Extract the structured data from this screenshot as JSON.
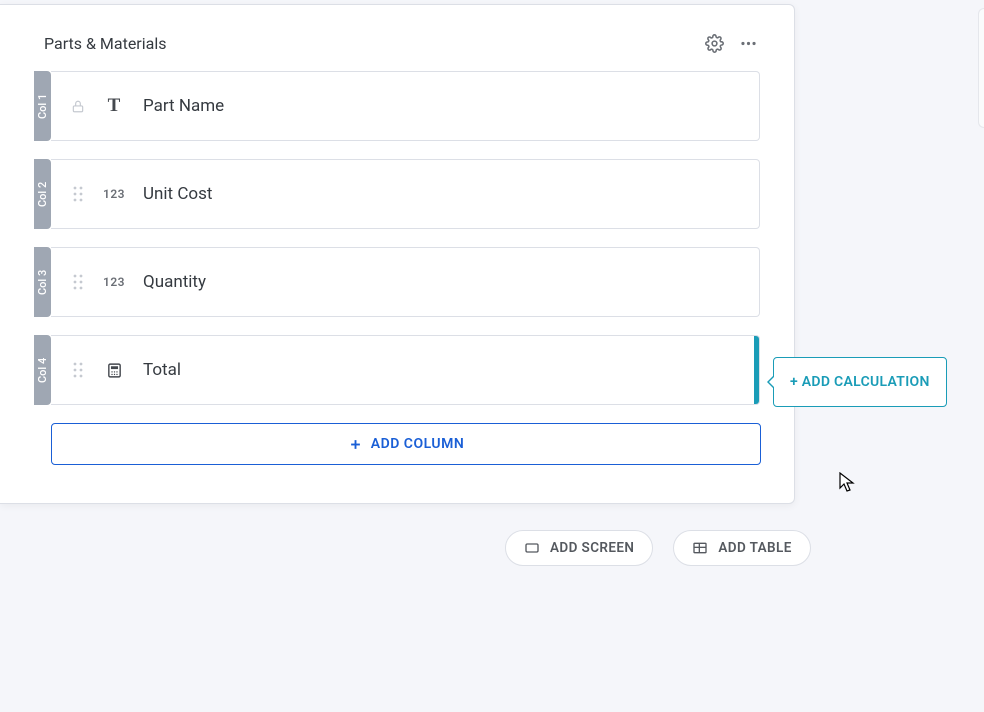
{
  "panel": {
    "title": "Parts & Materials"
  },
  "columns": [
    {
      "tab": "Col 1",
      "name": "Part Name",
      "type": "text",
      "locked": true,
      "active": false
    },
    {
      "tab": "Col 2",
      "name": "Unit Cost",
      "type": "number",
      "locked": false,
      "active": false
    },
    {
      "tab": "Col 3",
      "name": "Quantity",
      "type": "number",
      "locked": false,
      "active": false
    },
    {
      "tab": "Col 4",
      "name": "Total",
      "type": "calc",
      "locked": false,
      "active": true
    }
  ],
  "buttons": {
    "add_column": "ADD COLUMN",
    "add_calculation": "+ ADD CALCULATION",
    "add_screen": "ADD SCREEN",
    "add_table": "ADD TABLE"
  },
  "type_labels": {
    "text": "T",
    "number": "123"
  }
}
